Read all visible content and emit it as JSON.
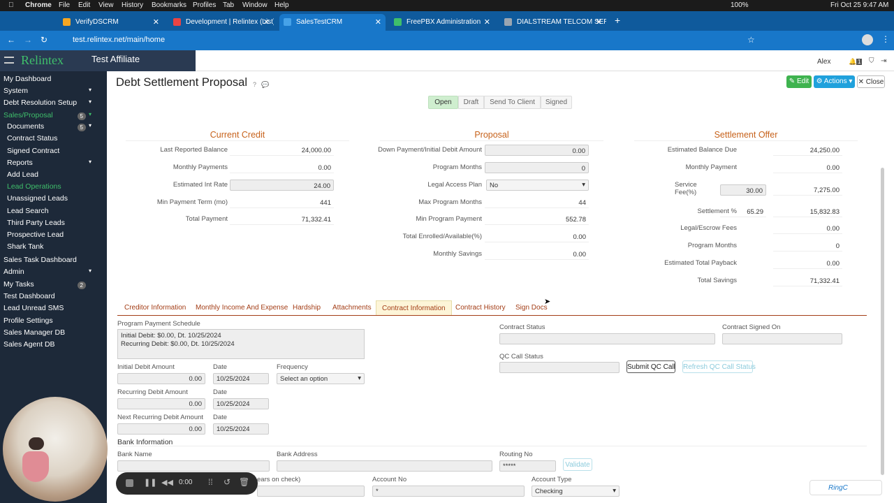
{
  "menubar": {
    "app": "Chrome",
    "items": [
      "File",
      "Edit",
      "View",
      "History",
      "Bookmarks",
      "Profiles",
      "Tab",
      "Window",
      "Help"
    ],
    "battery": "100%",
    "datetime": "Fri Oct 25  9:47 AM"
  },
  "tabs": [
    {
      "label": "VerifyDSCRM",
      "color": "#f5a623"
    },
    {
      "label": "Development | Relintex (List)",
      "color": "#e94444"
    },
    {
      "label": "SalesTestCRM",
      "color": "#46a2e8"
    },
    {
      "label": "FreePBX Administration",
      "color": "#3fbf6b"
    },
    {
      "label": "DIALSTREAM TELCOM SERVI",
      "color": "#9aa5b1"
    }
  ],
  "url": "test.relintex.net/main/home",
  "brand": {
    "logo": "Relintex",
    "affiliate": "Test Affiliate",
    "user": "Alex",
    "notif_count": "1"
  },
  "sidebar": [
    {
      "label": "My Dashboard",
      "sub": false,
      "green": false
    },
    {
      "label": "System",
      "sub": false,
      "green": false,
      "caret": true
    },
    {
      "label": "Debt Resolution Setup",
      "sub": false,
      "green": false,
      "caret": true
    },
    {
      "label": "Sales/Proposal",
      "sub": false,
      "green": true,
      "badge": "5",
      "caret": true
    },
    {
      "label": "Documents",
      "sub": true,
      "green": false,
      "badge": "5",
      "caret": true
    },
    {
      "label": "Contract Status",
      "sub": true,
      "green": false
    },
    {
      "label": "Signed Contract",
      "sub": true,
      "green": false
    },
    {
      "label": "Reports",
      "sub": true,
      "green": false,
      "caret": true
    },
    {
      "label": "Add Lead",
      "sub": true,
      "green": false
    },
    {
      "label": "Lead Operations",
      "sub": true,
      "green": true
    },
    {
      "label": "Unassigned Leads",
      "sub": true,
      "green": false
    },
    {
      "label": "Lead Search",
      "sub": true,
      "green": false
    },
    {
      "label": "Third Party Leads",
      "sub": true,
      "green": false
    },
    {
      "label": "Prospective Lead",
      "sub": true,
      "green": false
    },
    {
      "label": "Shark Tank",
      "sub": true,
      "green": false
    },
    {
      "label": "Sales Task Dashboard",
      "sub": false,
      "green": false
    },
    {
      "label": "Admin",
      "sub": false,
      "green": false,
      "caret": true
    },
    {
      "label": "My Tasks",
      "sub": false,
      "green": false,
      "badge": "2"
    },
    {
      "label": "Test Dashboard",
      "sub": false,
      "green": false
    },
    {
      "label": "Lead Unread SMS",
      "sub": false,
      "green": false
    },
    {
      "label": "Profile Settings",
      "sub": false,
      "green": false
    },
    {
      "label": "Sales Manager DB",
      "sub": false,
      "green": false
    },
    {
      "label": "Sales Agent DB",
      "sub": false,
      "green": false
    }
  ],
  "page": {
    "title": "Debt Settlement Proposal",
    "help": "?",
    "edit": "Edit",
    "actions": "Actions",
    "close": "Close"
  },
  "status_tabs": [
    "Open",
    "Draft",
    "Send To Client",
    "Signed"
  ],
  "current_credit": {
    "title": "Current Credit",
    "rows": [
      {
        "label": "Last Reported Balance",
        "value": "24,000.00",
        "box": false
      },
      {
        "label": "Monthly Payments",
        "value": "0.00",
        "box": false
      },
      {
        "label": "Estimated Int Rate",
        "value": "24.00",
        "box": true
      },
      {
        "label": "Min Payment Term (mo)",
        "value": "441",
        "box": false
      },
      {
        "label": "Total Payment",
        "value": "71,332.41",
        "box": false
      }
    ]
  },
  "proposal": {
    "title": "Proposal",
    "rows": [
      {
        "label": "Down Payment/Initial Debit Amount",
        "value": "0.00",
        "box": true
      },
      {
        "label": "Program Months",
        "value": "0",
        "box": true
      },
      {
        "label": "Legal Access Plan",
        "value": "No",
        "box": "select"
      },
      {
        "label": "Max Program Months",
        "value": "44",
        "box": false
      },
      {
        "label": "Min Program Payment",
        "value": "552.78",
        "box": false
      },
      {
        "label": "Total Enrolled/Available(%)",
        "value": "0.00",
        "box": false
      },
      {
        "label": "Monthly Savings",
        "value": "0.00",
        "box": false
      }
    ]
  },
  "settlement": {
    "title": "Settlement Offer",
    "rows": [
      {
        "label": "Estimated Balance Due",
        "value": "24,250.00"
      },
      {
        "label": "Monthly Payment",
        "value": "0.00"
      },
      {
        "label": "Service Fee(%)",
        "pct": "30.00",
        "value": "7,275.00"
      },
      {
        "label": "Settlement %",
        "pct": "65.29",
        "value": "15,832.83"
      },
      {
        "label": "Legal/Escrow Fees",
        "value": "0.00"
      },
      {
        "label": "Program Months",
        "value": "0"
      },
      {
        "label": "Estimated Total Payback",
        "value": "0.00"
      },
      {
        "label": "Total Savings",
        "value": "71,332.41"
      }
    ]
  },
  "detail_tabs": [
    "Creditor Information",
    "Monthly Income And Expense",
    "Hardship",
    "Attachments",
    "Contract Information",
    "Contract History",
    "Sign Docs"
  ],
  "contract": {
    "schedule_label": "Program Payment Schedule",
    "schedule_lines": [
      "Initial Debit: $0.00, Dt. 10/25/2024",
      "Recurring Debit: $0.00, Dt. 10/25/2024"
    ],
    "initial_label": "Initial Debit Amount",
    "initial_value": "0.00",
    "date_label": "Date",
    "initial_date": "10/25/2024",
    "frequency_label": "Frequency",
    "frequency_value": "Select an option",
    "recurring_label": "Recurring Debit Amount",
    "recurring_value": "0.00",
    "recurring_date": "10/25/2024",
    "next_label": "Next Recurring Debit Amount",
    "next_value": "0.00",
    "next_date": "10/25/2024",
    "status_label": "Contract Status",
    "signed_label": "Contract Signed On",
    "qc_label": "QC Call Status",
    "submit_qc": "Submit QC Call",
    "refresh_qc": "Refresh QC Call Status"
  },
  "bank": {
    "title": "Bank Information",
    "name_label": "Bank Name",
    "address_label": "Bank Address",
    "routing_label": "Routing No",
    "routing_value": "*****",
    "validate": "Validate",
    "partial_label": "ears on check)",
    "account_no_label": "Account No",
    "account_no_value": "*",
    "account_type_label": "Account Type",
    "account_type_value": "Checking"
  },
  "recorder": {
    "time": "0:00"
  },
  "ringc": "RingC"
}
